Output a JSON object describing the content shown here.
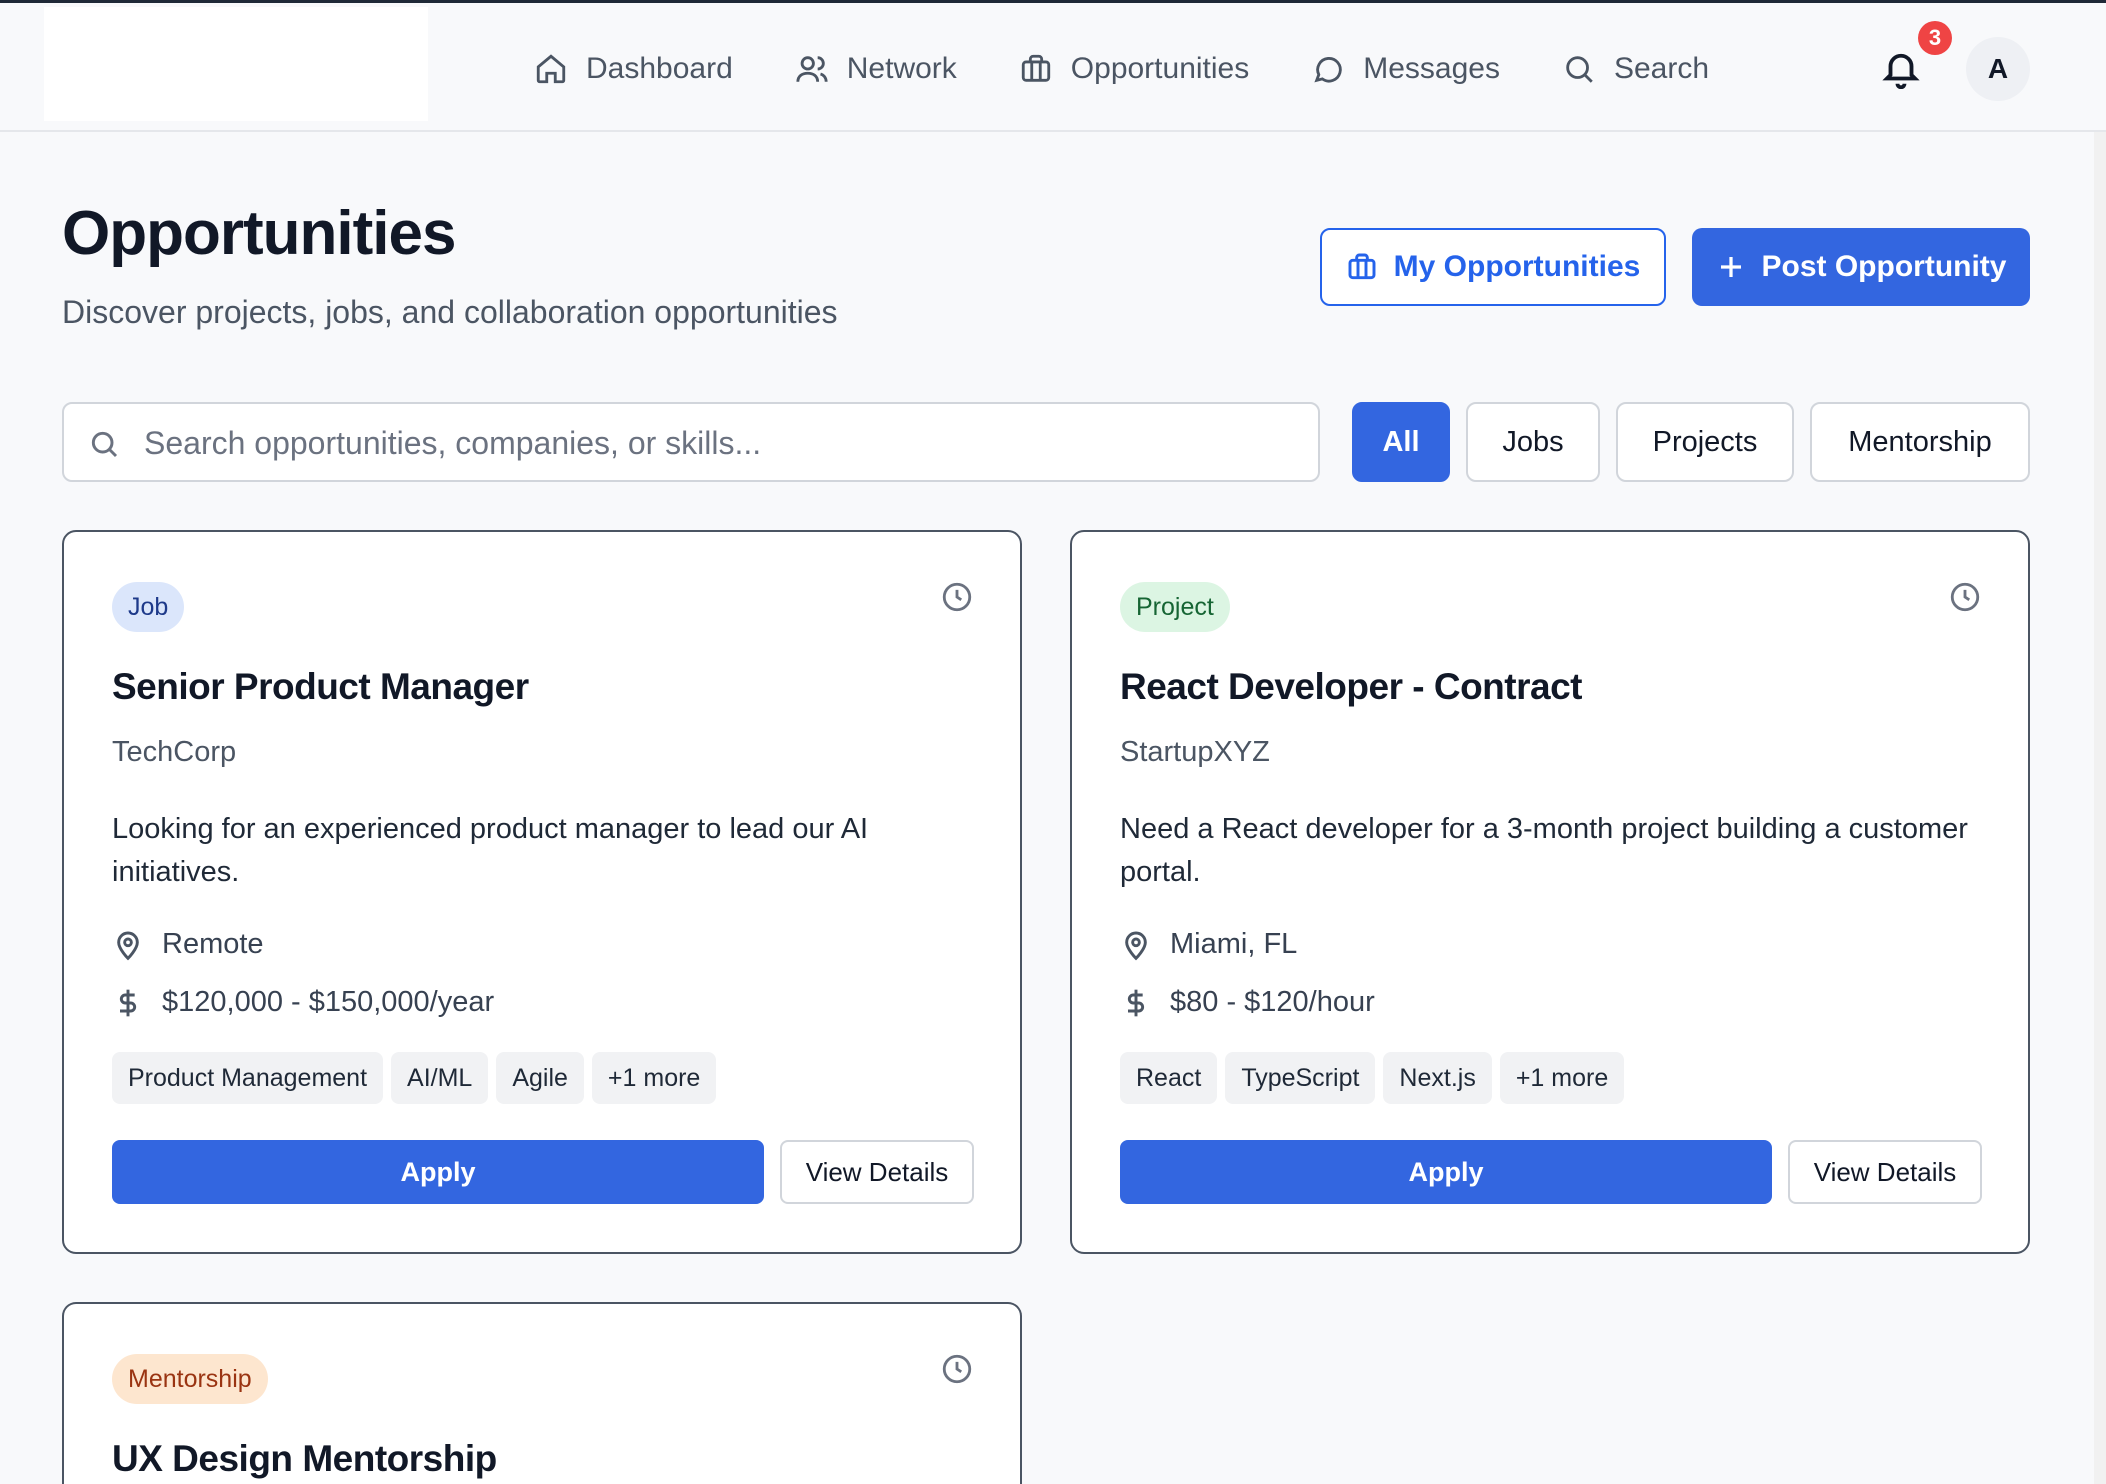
{
  "nav": {
    "items": [
      {
        "label": "Dashboard",
        "icon": "home-icon"
      },
      {
        "label": "Network",
        "icon": "users-icon"
      },
      {
        "label": "Opportunities",
        "icon": "briefcase-icon"
      },
      {
        "label": "Messages",
        "icon": "message-icon"
      },
      {
        "label": "Search",
        "icon": "search-icon"
      }
    ],
    "notification_count": "3",
    "avatar_initial": "A"
  },
  "page": {
    "title": "Opportunities",
    "subtitle": "Discover projects, jobs, and collaboration opportunities",
    "my_opportunities_label": "My Opportunities",
    "post_opportunity_label": "Post Opportunity"
  },
  "search": {
    "placeholder": "Search opportunities, companies, or skills...",
    "value": ""
  },
  "filters": [
    {
      "label": "All",
      "active": true
    },
    {
      "label": "Jobs",
      "active": false
    },
    {
      "label": "Projects",
      "active": false
    },
    {
      "label": "Mentorship",
      "active": false
    }
  ],
  "cards": [
    {
      "type": "Job",
      "title": "Senior Product Manager",
      "company": "TechCorp",
      "description": "Looking for an experienced product manager to lead our AI initiatives.",
      "location": "Remote",
      "compensation": "$120,000 - $150,000/year",
      "skills": [
        "Product Management",
        "AI/ML",
        "Agile",
        "+1 more"
      ],
      "apply_label": "Apply",
      "details_label": "View Details"
    },
    {
      "type": "Project",
      "title": "React Developer - Contract",
      "company": "StartupXYZ",
      "description": "Need a React developer for a 3-month project building a customer portal.",
      "location": "Miami, FL",
      "compensation": "$80 - $120/hour",
      "skills": [
        "React",
        "TypeScript",
        "Next.js",
        "+1 more"
      ],
      "apply_label": "Apply",
      "details_label": "View Details"
    },
    {
      "type": "Mentorship",
      "title": "UX Design Mentorship"
    }
  ],
  "colors": {
    "primary": "#3366e0",
    "job_tag_bg": "#dbe6fb",
    "project_tag_bg": "#dcf5e3",
    "mentorship_tag_bg": "#fde6cf",
    "notification_badge": "#ef4444"
  }
}
